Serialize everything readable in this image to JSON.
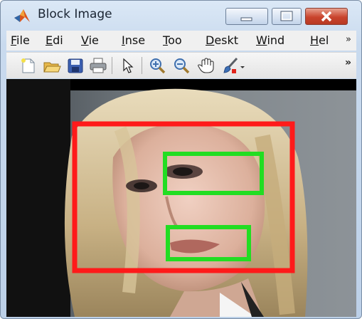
{
  "window": {
    "title": "Block Image"
  },
  "menubar": {
    "items": [
      {
        "name": "file",
        "key": "F",
        "rest": "ile"
      },
      {
        "name": "edit",
        "key": "E",
        "rest": "di"
      },
      {
        "name": "view",
        "key": "V",
        "rest": "ie"
      },
      {
        "name": "insert",
        "key": "I",
        "rest": "nse"
      },
      {
        "name": "tools",
        "key": "T",
        "rest": "oo"
      },
      {
        "name": "desktop",
        "key": "D",
        "rest": "eskt"
      },
      {
        "name": "window",
        "key": "W",
        "rest": "ind"
      },
      {
        "name": "help",
        "key": "H",
        "rest": "el"
      }
    ],
    "overflow": "»"
  },
  "toolbar": {
    "icons": [
      "new-figure-icon",
      "open-file-icon",
      "save-icon",
      "print-icon",
      "pointer-icon",
      "zoom-in-icon",
      "zoom-out-icon",
      "pan-hand-icon",
      "data-brush-icon",
      "dropdown-arrow-icon"
    ],
    "overflow": "»"
  },
  "image": {
    "face_box_color": "#ff1a1a",
    "feature_box_color": "#22dd22",
    "boxes": [
      "face",
      "eyes",
      "mouth"
    ]
  },
  "colors": {
    "close_button": "#c9442d",
    "canvas_background": "#000000"
  }
}
